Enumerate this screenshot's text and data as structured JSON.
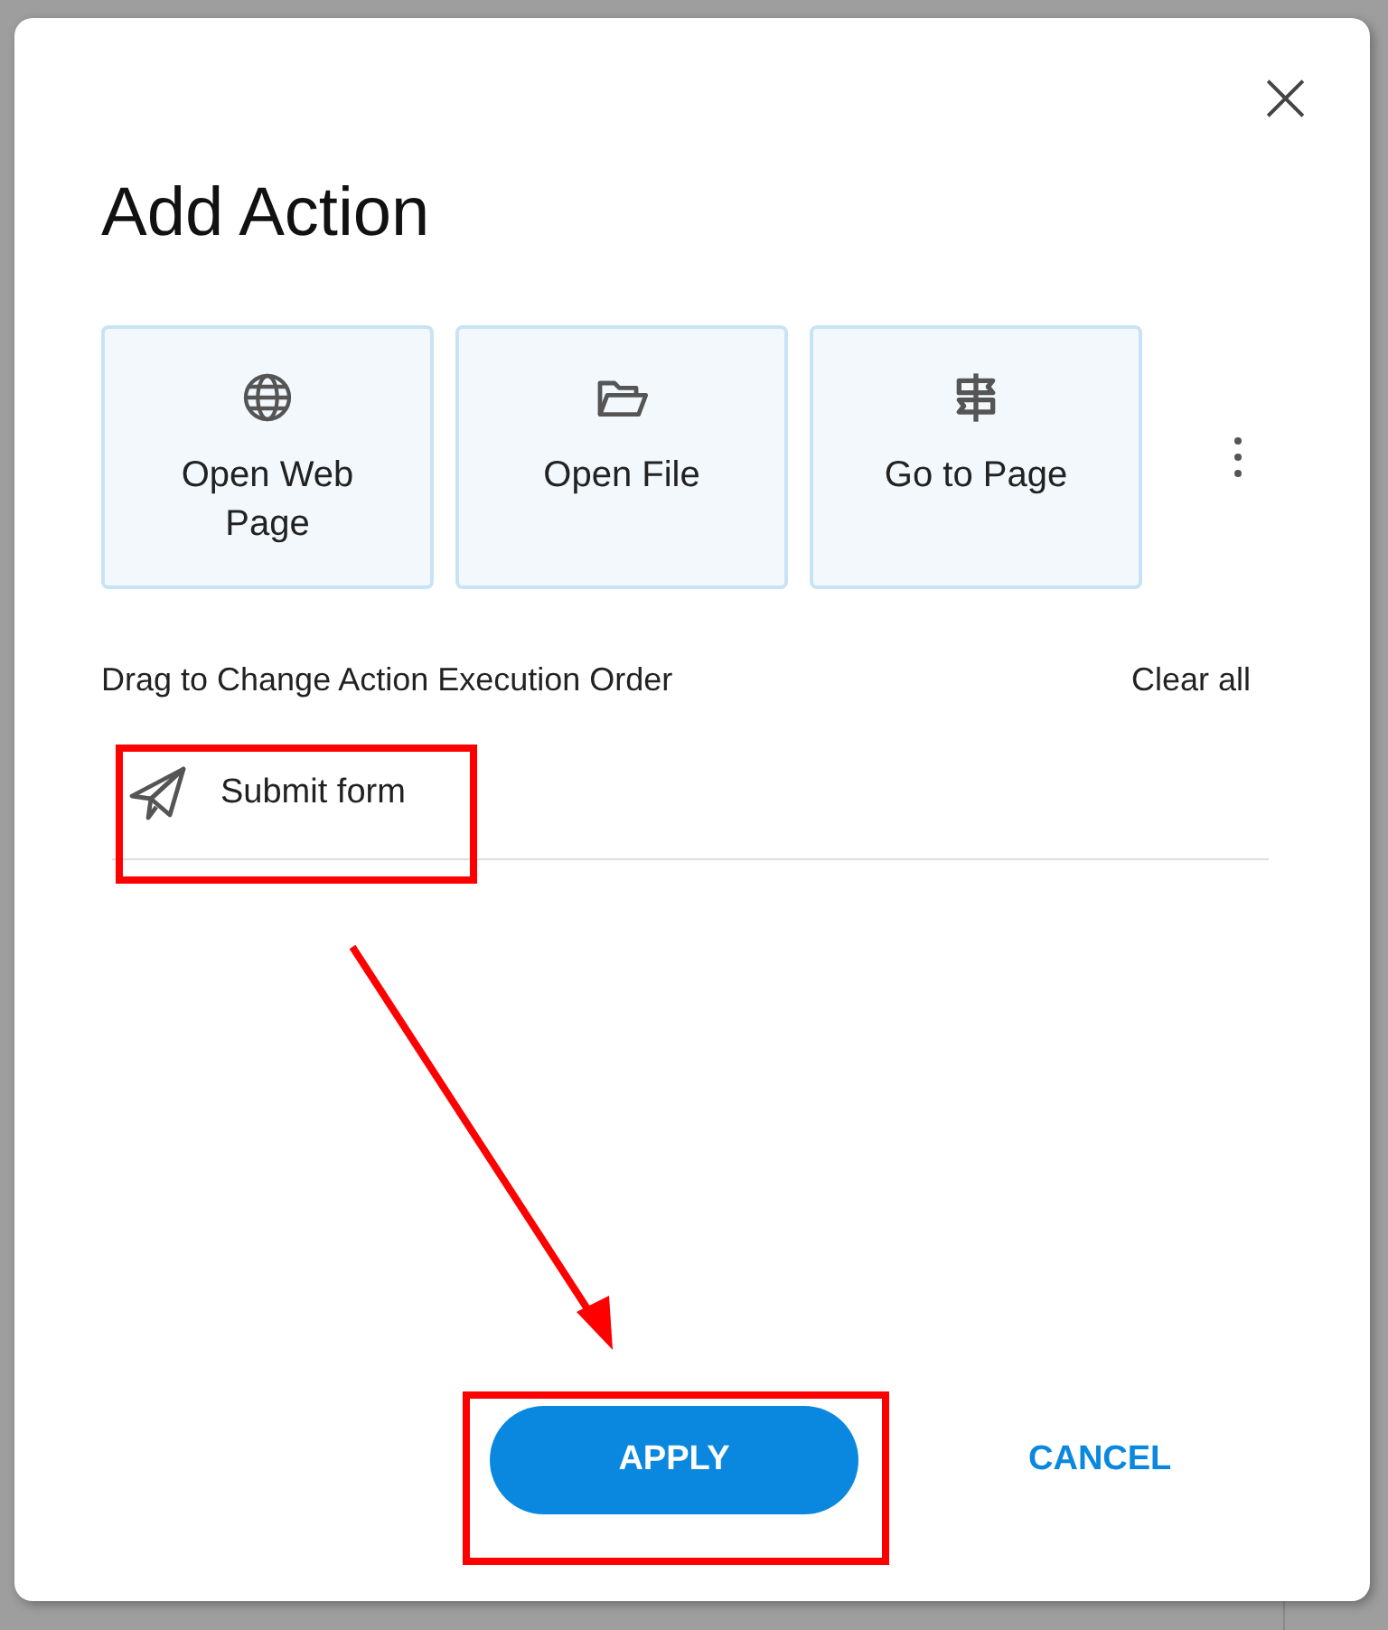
{
  "dialog": {
    "title": "Add Action",
    "close_label": "×"
  },
  "action_types": [
    {
      "label": "Open Web Page",
      "kind": "globe"
    },
    {
      "label": "Open File",
      "kind": "folder"
    },
    {
      "label": "Go to Page",
      "kind": "signpost"
    }
  ],
  "order_header": {
    "label": "Drag to Change Action Execution Order",
    "clear_label": "Clear all"
  },
  "actions": [
    {
      "label": "Submit form",
      "kind": "send"
    }
  ],
  "buttons": [
    {
      "label": "APPLY",
      "kind": "primary"
    },
    {
      "label": "CANCEL",
      "kind": "text"
    }
  ],
  "annotations": [
    {
      "kind": "action_box"
    },
    {
      "kind": "arrow"
    },
    {
      "kind": "button_box"
    }
  ]
}
